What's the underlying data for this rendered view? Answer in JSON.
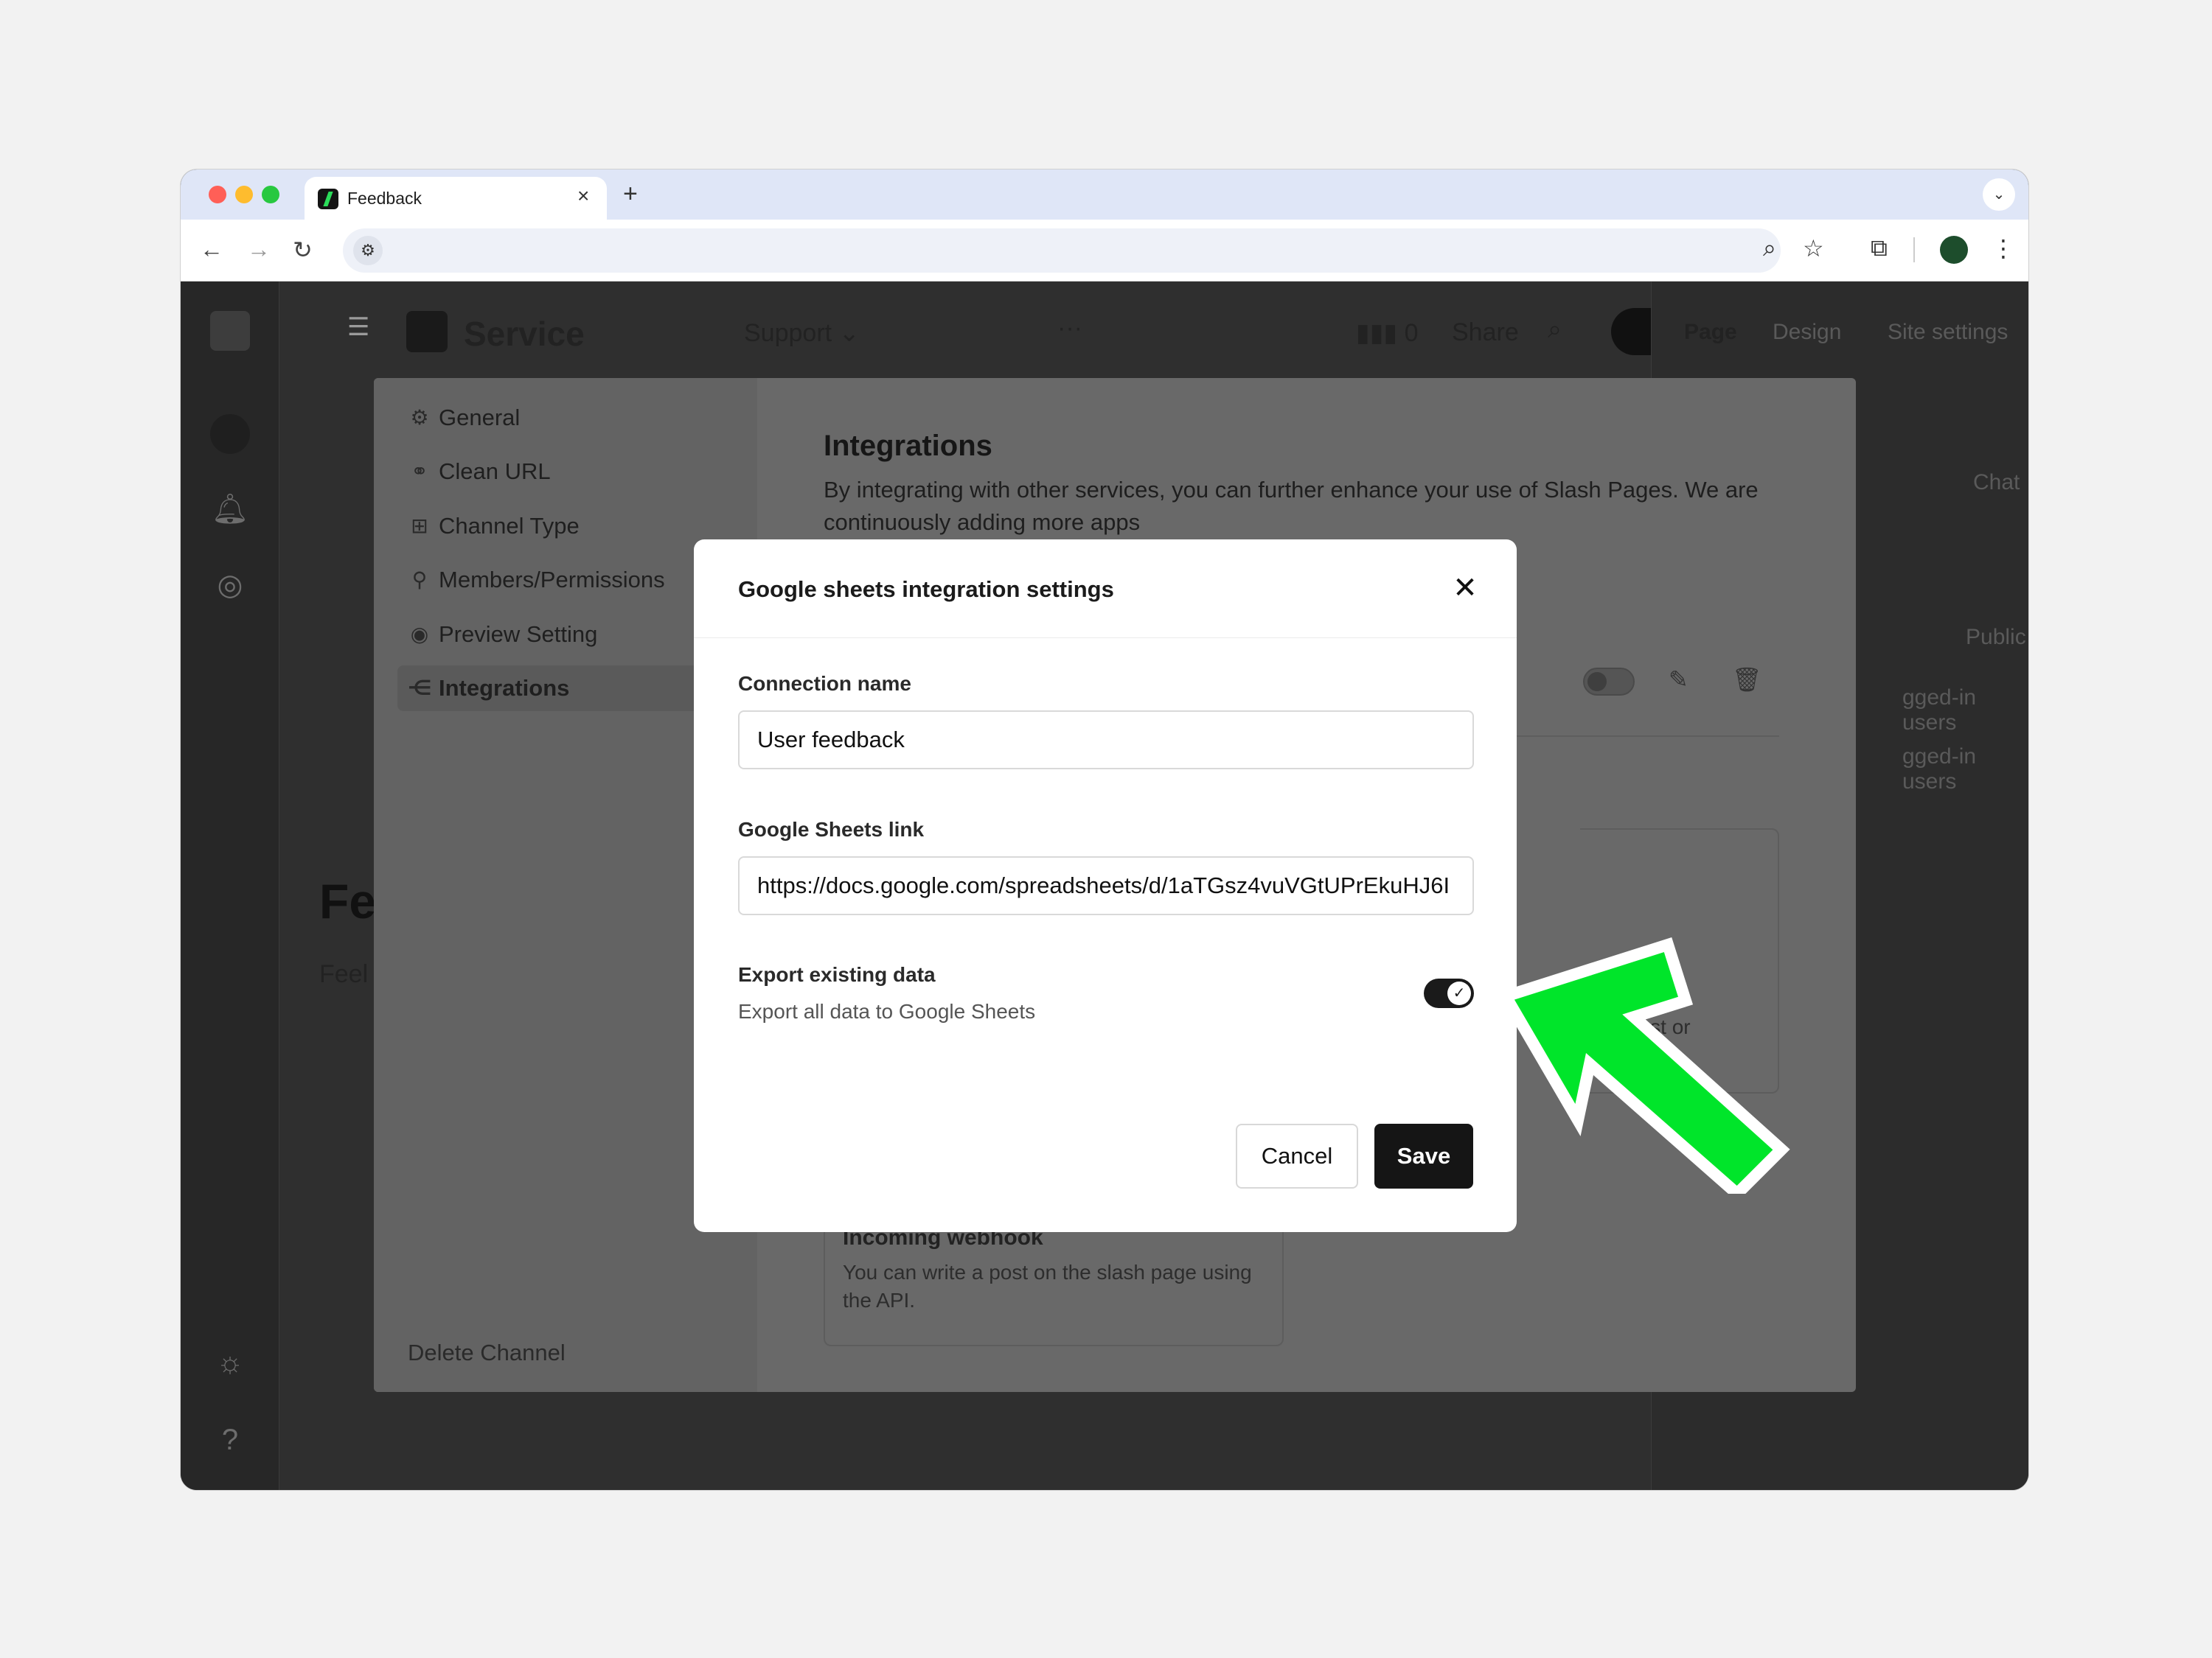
{
  "browser": {
    "tab_title": "Feedback",
    "tab_close": "×",
    "new_tab": "+",
    "tab_menu": "⌄",
    "icons": [
      "back-icon",
      "forward-icon",
      "reload-icon",
      "site-settings-icon",
      "zoom-icon",
      "bookmark-star-icon",
      "extensions-icon",
      "profile-icon",
      "menu-icon"
    ]
  },
  "app": {
    "workspace_name": "Service",
    "channel_menu": "Support",
    "views_count": "0",
    "share_label": "Share",
    "right_tabs": [
      "Page",
      "Design",
      "Site settings"
    ],
    "right_values": [
      "Chat",
      "Public",
      "gged-in users",
      "gged-in users"
    ],
    "accent_color": "#2bdc5a"
  },
  "settings": {
    "nav": [
      {
        "label": "General",
        "icon": "gear-icon"
      },
      {
        "label": "Clean URL",
        "icon": "link-icon"
      },
      {
        "label": "Channel Type",
        "icon": "layout-icon"
      },
      {
        "label": "Members/Permissions",
        "icon": "person-icon"
      },
      {
        "label": "Preview Setting",
        "icon": "preview-icon"
      },
      {
        "label": "Integrations",
        "icon": "integrations-icon"
      }
    ],
    "active": "Integrations",
    "delete_channel": "Delete Channel",
    "title": "Integrations",
    "description": "By integrating with other services, you can further enhance your use of Slash Pages. We are continuously adding more apps",
    "webhook_title": "Incoming webhook",
    "webhook_desc": "You can write a post on the slash page using the API.",
    "card_fragment": "post or"
  },
  "behind": {
    "heading_fragment": "Fe",
    "text_fragment": "Feel"
  },
  "modal": {
    "title": "Google sheets integration settings",
    "close": "✕",
    "connection_label": "Connection name",
    "connection_value": "User feedback",
    "link_label": "Google Sheets link",
    "link_value": "https://docs.google.com/spreadsheets/d/1aTGsz4vuVGtUPrEkuHJ6I",
    "export_title": "Export existing data",
    "export_sub": "Export all data to Google Sheets",
    "export_enabled": true,
    "cancel": "Cancel",
    "save": "Save"
  },
  "annotation": {
    "arrow_color": "#00e52a"
  }
}
